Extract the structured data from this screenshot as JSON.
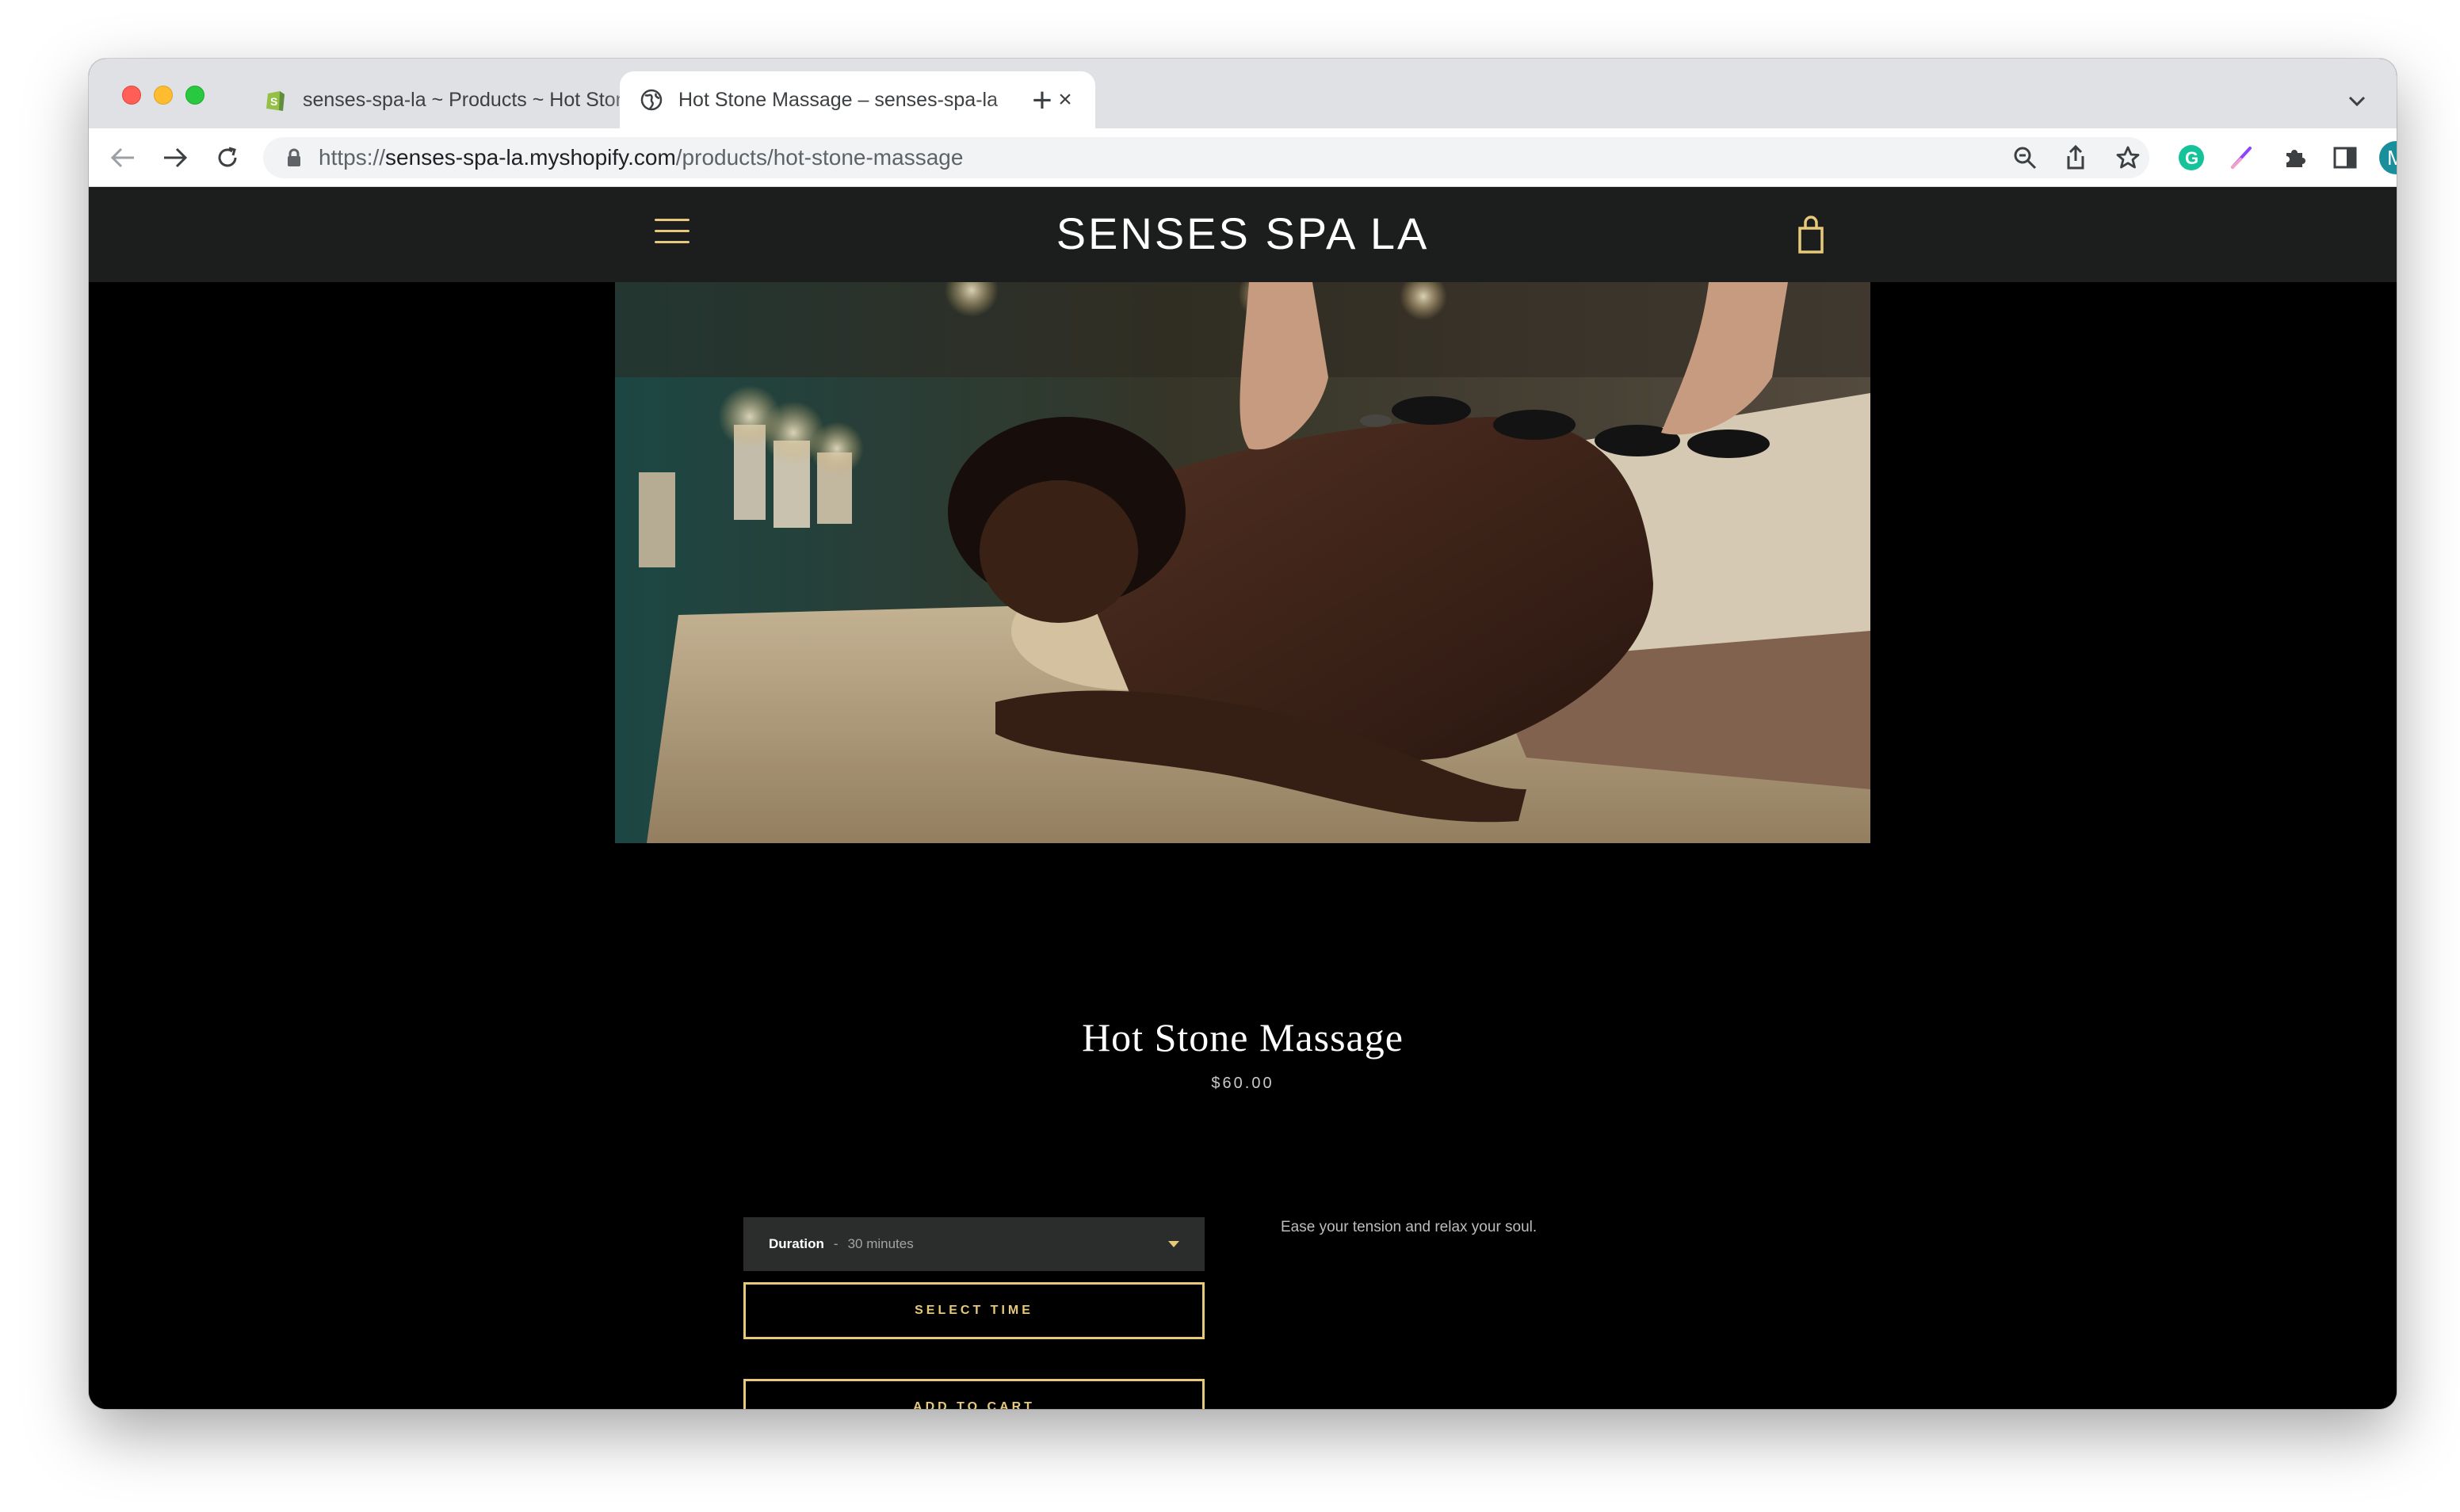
{
  "browser": {
    "tabs": [
      {
        "title": "senses-spa-la ~ Products ~ Hot Stone Massage",
        "active": false,
        "icon": "shopify-icon"
      },
      {
        "title": "Hot Stone Massage – senses-spa-la",
        "active": true,
        "icon": "globe-icon"
      }
    ],
    "url": {
      "scheme": "https://",
      "host": "senses-spa-la.myshopify.com",
      "path": "/products/hot-stone-massage"
    },
    "profile_initial": "M"
  },
  "site": {
    "logo": "SENSES SPA LA",
    "accent_color": "#e6c97a"
  },
  "product": {
    "title": "Hot Stone Massage",
    "price": "$60.00",
    "variant": {
      "label": "Duration",
      "separator": "-",
      "value": "30 minutes"
    },
    "select_time_label": "SELECT TIME",
    "add_to_cart_label": "ADD TO CART",
    "description": "Ease your tension and relax your soul."
  }
}
